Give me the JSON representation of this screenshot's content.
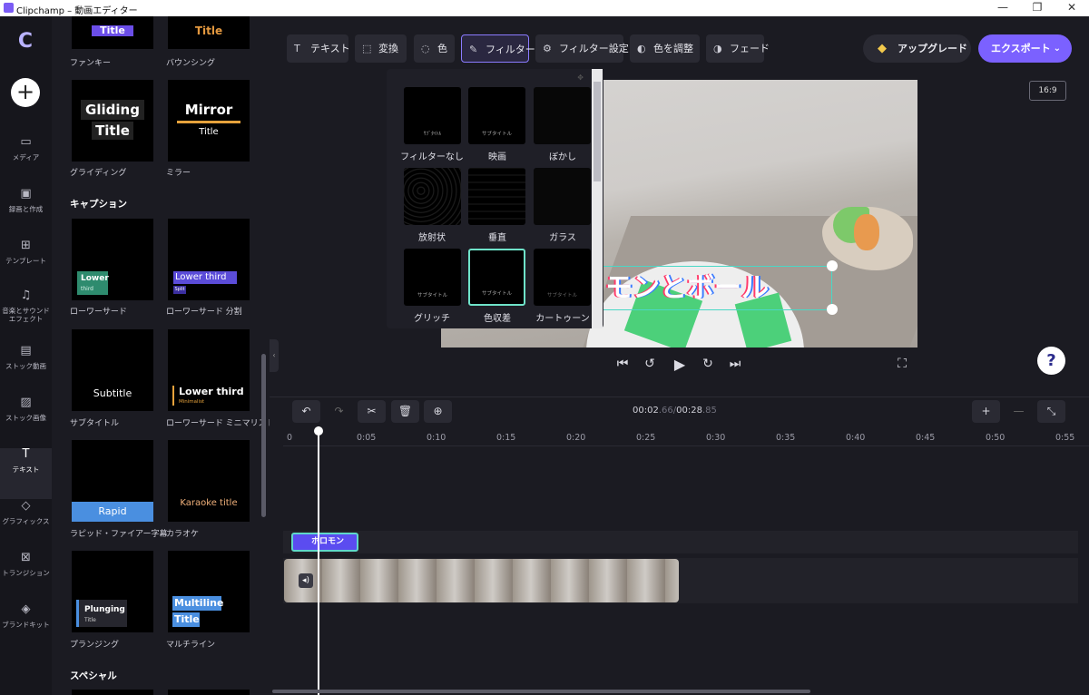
{
  "window": {
    "title": "Clipchamp – 動画エディター",
    "minimize": "—",
    "maximize": "❐",
    "close": "✕"
  },
  "nav": {
    "logo": "C",
    "add": "+",
    "items": [
      {
        "label": "メディア",
        "icon": "▭"
      },
      {
        "label": "録画と作成",
        "icon": "▣"
      },
      {
        "label": "テンプレート",
        "icon": "⊞"
      },
      {
        "label": "音楽とサウンド エフェクト",
        "icon": "♫"
      },
      {
        "label": "ストック動画",
        "icon": "▤"
      },
      {
        "label": "ストック画像",
        "icon": "▨"
      },
      {
        "label": "テキスト",
        "icon": "T"
      },
      {
        "label": "グラフィックス",
        "icon": "◇"
      },
      {
        "label": "トランジション",
        "icon": "⊠"
      },
      {
        "label": "ブランドキット",
        "icon": "◈"
      }
    ]
  },
  "library": {
    "top_row": {
      "left_label": "ファンキー",
      "right_label": "バウンシング",
      "left_thumb": "Title",
      "right_thumb": "Title"
    },
    "row2": {
      "left_label": "グライディング",
      "right_label": "ミラー",
      "left_thumb_1": "Gliding",
      "left_thumb_2": "Title",
      "right_thumb_1": "Mirror",
      "right_thumb_2": "Title"
    },
    "caption_header": "キャプション",
    "row3": {
      "left_label": "ローワーサード",
      "right_label": "ローワーサード 分割",
      "left_thumb_1": "Lower",
      "left_thumb_2": "third",
      "right_thumb_1": "Lower third",
      "right_thumb_2": "Split"
    },
    "row4": {
      "left_label": "サブタイトル",
      "right_label": "ローワーサード ミニマリスト",
      "left_thumb": "Subtitle",
      "right_thumb_1": "Lower third",
      "right_thumb_2": "Minimalist"
    },
    "row5": {
      "left_label": "ラピッド・ファイアー字幕",
      "right_label": "カラオケ",
      "left_thumb": "Rapid",
      "right_thumb": "Karaoke title"
    },
    "row6": {
      "left_label": "プランジング",
      "right_label": "マルチライン",
      "left_thumb_1": "Plunging",
      "left_thumb_2": "Title",
      "right_thumb_1": "Multiline",
      "right_thumb_2": "Title"
    },
    "special_header": "スペシャル"
  },
  "toolbar": [
    {
      "label": "テキスト",
      "icon": "T"
    },
    {
      "label": "変換",
      "icon": "⬚"
    },
    {
      "label": "色",
      "icon": "◌"
    },
    {
      "label": "フィルター",
      "icon": "✎"
    },
    {
      "label": "フィルター設定",
      "icon": "⚙"
    },
    {
      "label": "色を調整",
      "icon": "◐"
    },
    {
      "label": "フェード",
      "icon": "◑"
    }
  ],
  "upgrade": {
    "label": "アップグレード",
    "icon": "◆"
  },
  "export": {
    "label": "エクスポート",
    "chevron": "⌄"
  },
  "aspect_ratio": "16:9",
  "filters": [
    {
      "label": "フィルターなし",
      "thumb": "ｻﾌﾞﾀｲﾄﾙ"
    },
    {
      "label": "映画",
      "thumb": "サブタイトル"
    },
    {
      "label": "ぼかし",
      "thumb": ""
    },
    {
      "label": "放射状",
      "thumb": ""
    },
    {
      "label": "垂直",
      "thumb": ""
    },
    {
      "label": "ガラス",
      "thumb": ""
    },
    {
      "label": "グリッチ",
      "thumb": "サブタイトル"
    },
    {
      "label": "色収差",
      "thumb": "サブタイトル"
    },
    {
      "label": "カートゥーン",
      "thumb": "サブタイトル"
    }
  ],
  "preview": {
    "caption_text": "モンとボール"
  },
  "playback": {
    "prev": "⏮",
    "back5": "↺",
    "play": "▶",
    "fwd5": "↻",
    "next": "⏭",
    "fullscreen": "⛶"
  },
  "help": "?",
  "timeline": {
    "current": "00:02",
    "current_frac": ".66",
    "sep": "/",
    "total": "00:28",
    "total_frac": ".85",
    "ticks": [
      "0",
      "0:05",
      "0:10",
      "0:15",
      "0:20",
      "0:25",
      "0:30",
      "0:35",
      "0:40",
      "0:45",
      "0:50",
      "0:55"
    ],
    "text_clip": "ホロモン",
    "tools": {
      "undo": "↶",
      "redo": "↷",
      "cut": "✂",
      "delete": "🗑",
      "add_media": "⊕",
      "zoom_in": "+",
      "zoom_out": "—",
      "fit": "⤡"
    }
  }
}
